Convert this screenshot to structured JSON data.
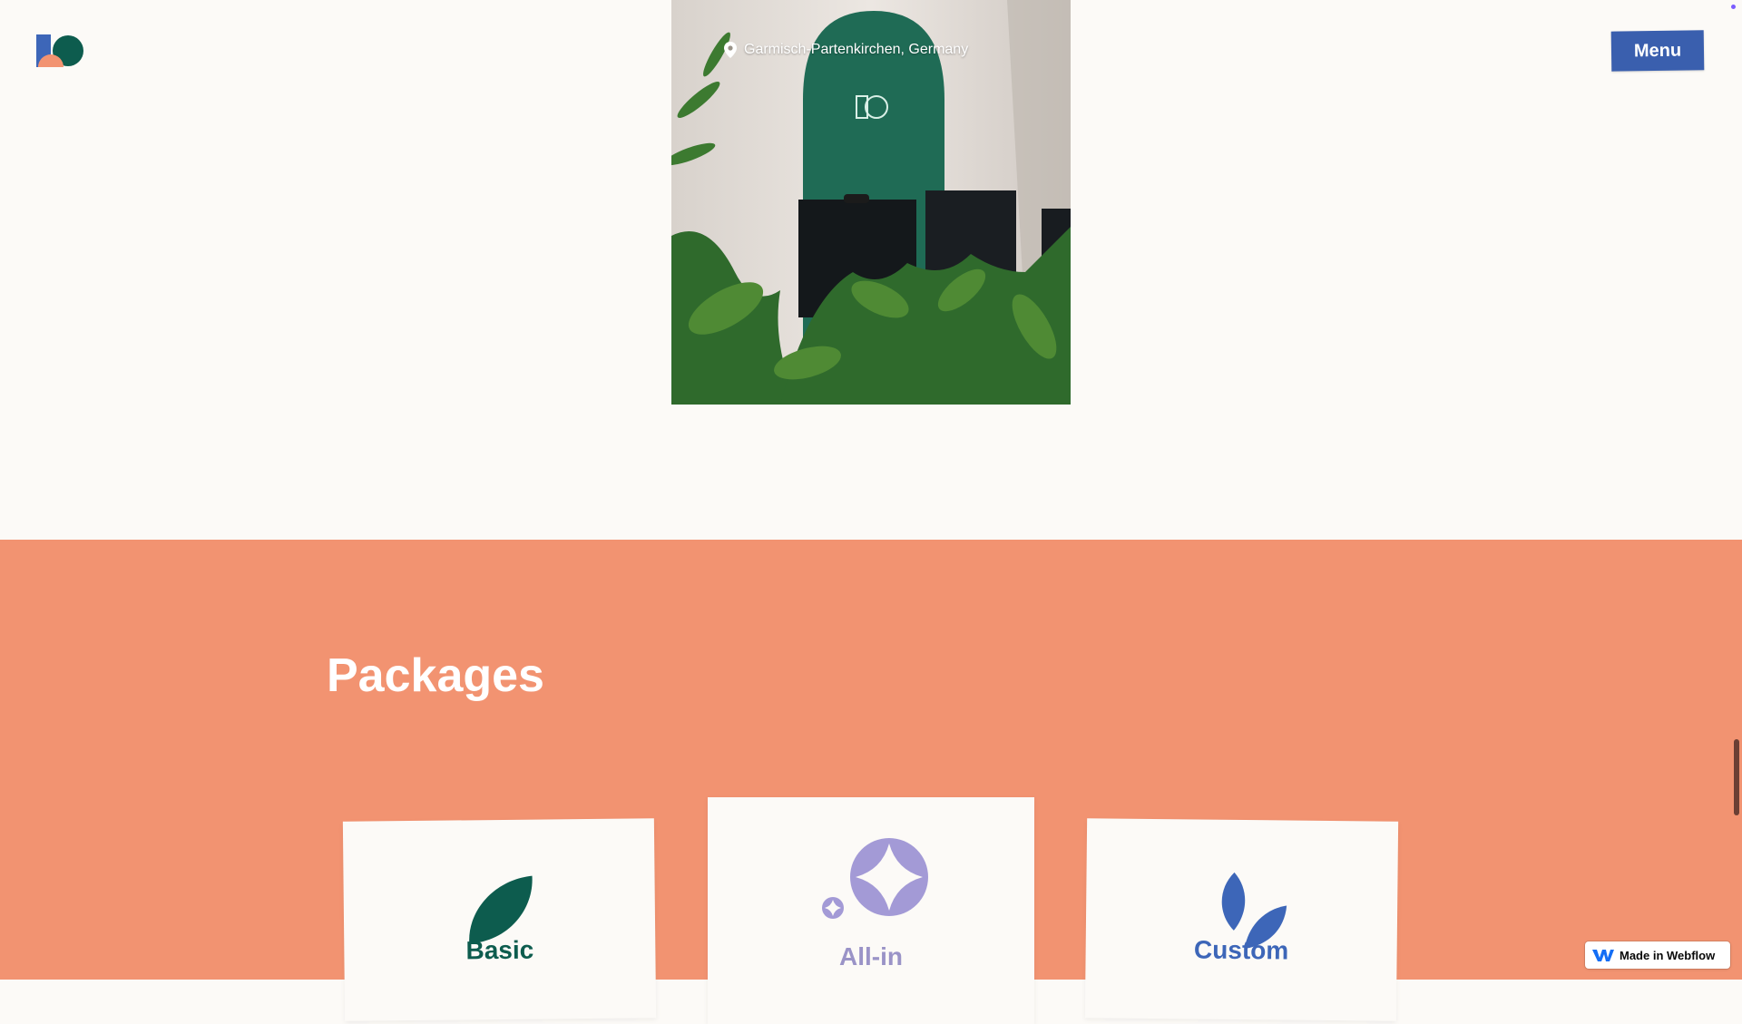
{
  "header": {
    "logo_icon": "brand-logo-icon",
    "menu_label": "Menu"
  },
  "hero": {
    "location_icon": "map-pin-icon",
    "location_text": "Garmisch-Partenkirchen, Germany"
  },
  "packages": {
    "title": "Packages",
    "cards": [
      {
        "name": "Basic",
        "icon": "leaf-icon",
        "color": "#0d5c4e"
      },
      {
        "name": "All-in",
        "icon": "sparkle-icon",
        "color": "#9a93c7"
      },
      {
        "name": "Custom",
        "icon": "twin-leaves-icon",
        "color": "#3d66b8"
      }
    ]
  },
  "badge": {
    "icon": "webflow-logo-icon",
    "label": "Made in Webflow"
  },
  "colors": {
    "background": "#fcfaf7",
    "packages_background": "#f29371",
    "menu_button": "#3a5fae"
  }
}
